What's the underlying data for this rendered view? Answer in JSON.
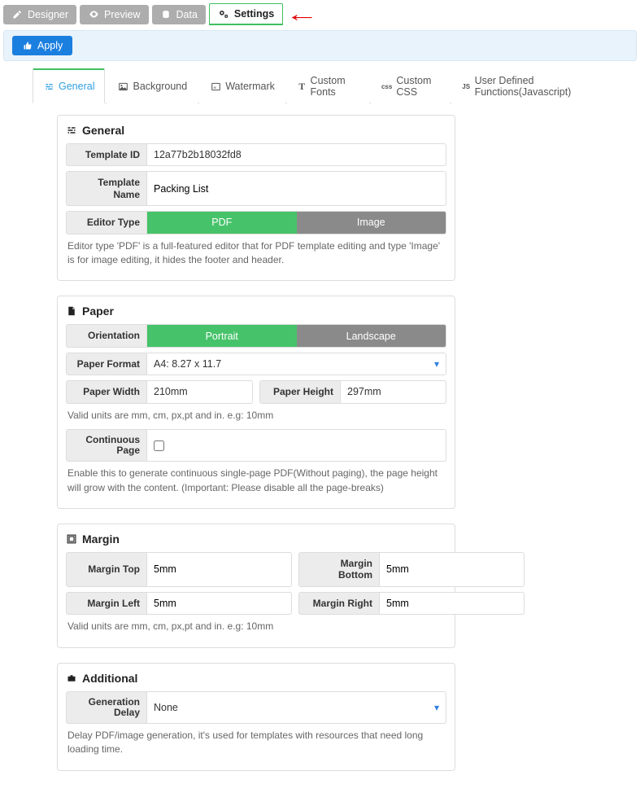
{
  "topTabs": {
    "designer": "Designer",
    "preview": "Preview",
    "data": "Data",
    "settings": "Settings"
  },
  "apply": "Apply",
  "subTabs": {
    "general": "General",
    "background": "Background",
    "watermark": "Watermark",
    "customFonts": "Custom Fonts",
    "customCss": "Custom CSS",
    "udf": "User Defined Functions(Javascript)"
  },
  "general": {
    "title": "General",
    "templateIdLabel": "Template ID",
    "templateId": "12a77b2b18032fd8",
    "templateNameLabel": "Template Name",
    "templateName": "Packing List",
    "editorTypeLabel": "Editor Type",
    "pdf": "PDF",
    "image": "Image",
    "editorHelp": "Editor type 'PDF' is a full-featured editor that for PDF template editing and type 'Image' is for image editing, it hides the footer and header."
  },
  "paper": {
    "title": "Paper",
    "orientationLabel": "Orientation",
    "portrait": "Portrait",
    "landscape": "Landscape",
    "formatLabel": "Paper Format",
    "format": "A4: 8.27 x 11.7",
    "widthLabel": "Paper Width",
    "width": "210mm",
    "heightLabel": "Paper Height",
    "height": "297mm",
    "unitsHelp": "Valid units are mm, cm, px,pt and in. e.g: 10mm",
    "contPageLabel": "Continuous Page",
    "contHelp": "Enable this to generate continuous single-page PDF(Without paging), the page height will grow with the content. (Important: Please disable all the page-breaks)"
  },
  "margin": {
    "title": "Margin",
    "topLabel": "Margin Top",
    "top": "5mm",
    "bottomLabel": "Margin Bottom",
    "bottom": "5mm",
    "leftLabel": "Margin Left",
    "left": "5mm",
    "rightLabel": "Margin Right",
    "right": "5mm",
    "help": "Valid units are mm, cm, px,pt and in. e.g: 10mm"
  },
  "additional": {
    "title": "Additional",
    "delayLabel": "Generation Delay",
    "delay": "None",
    "help": "Delay PDF/image generation, it's used for templates with resources that need long loading time."
  }
}
